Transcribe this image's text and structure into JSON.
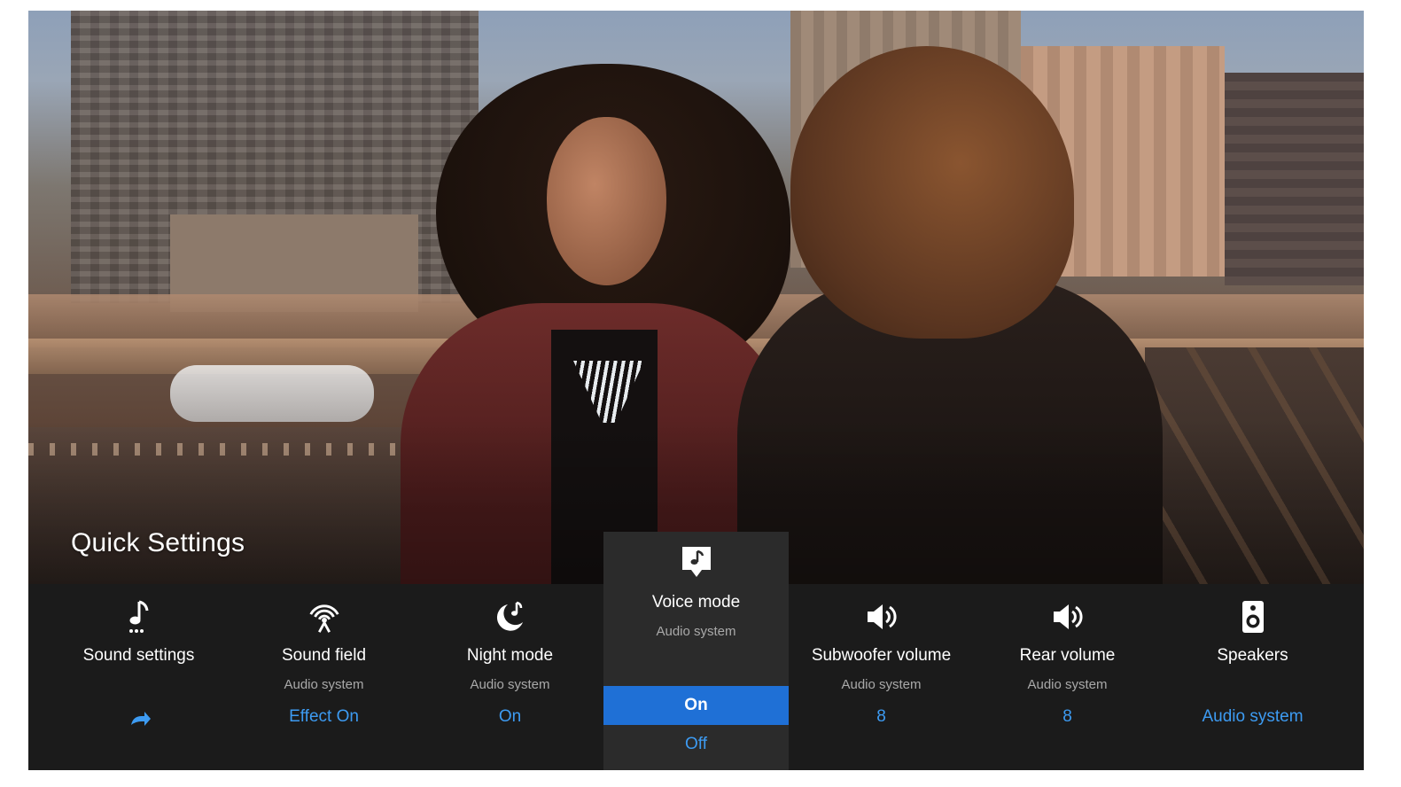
{
  "screen": {
    "title": "Quick Settings"
  },
  "tiles": [
    {
      "id": "sound-settings",
      "icon": "music-note-dots-icon",
      "label": "Sound settings",
      "sub": "",
      "value": "",
      "value_icon": "share-arrow-icon"
    },
    {
      "id": "sound-field",
      "icon": "signal-broadcast-icon",
      "label": "Sound field",
      "sub": "Audio system",
      "value": "Effect On"
    },
    {
      "id": "night-mode",
      "icon": "moon-note-icon",
      "label": "Night mode",
      "sub": "Audio system",
      "value": "On"
    },
    {
      "id": "voice-mode",
      "icon": "speech-bubble-note-icon",
      "label": "Voice mode",
      "sub": "Audio system",
      "options": [
        "On",
        "Off"
      ],
      "selected": "On"
    },
    {
      "id": "subwoofer-volume",
      "icon": "speaker-volume-icon",
      "label": "Subwoofer volume",
      "sub": "Audio system",
      "value": "8"
    },
    {
      "id": "rear-volume",
      "icon": "speaker-volume-icon",
      "label": "Rear volume",
      "sub": "Audio system",
      "value": "8"
    },
    {
      "id": "speakers",
      "icon": "speaker-box-icon",
      "label": "Speakers",
      "sub": "",
      "value": "Audio system"
    }
  ],
  "colors": {
    "panel_bg": "#1b1b1b",
    "active_tile_bg": "#2b2b2b",
    "accent": "#3d9bf2",
    "selected_option_bg": "#1f70d6",
    "subtext": "#a9a9a9"
  }
}
